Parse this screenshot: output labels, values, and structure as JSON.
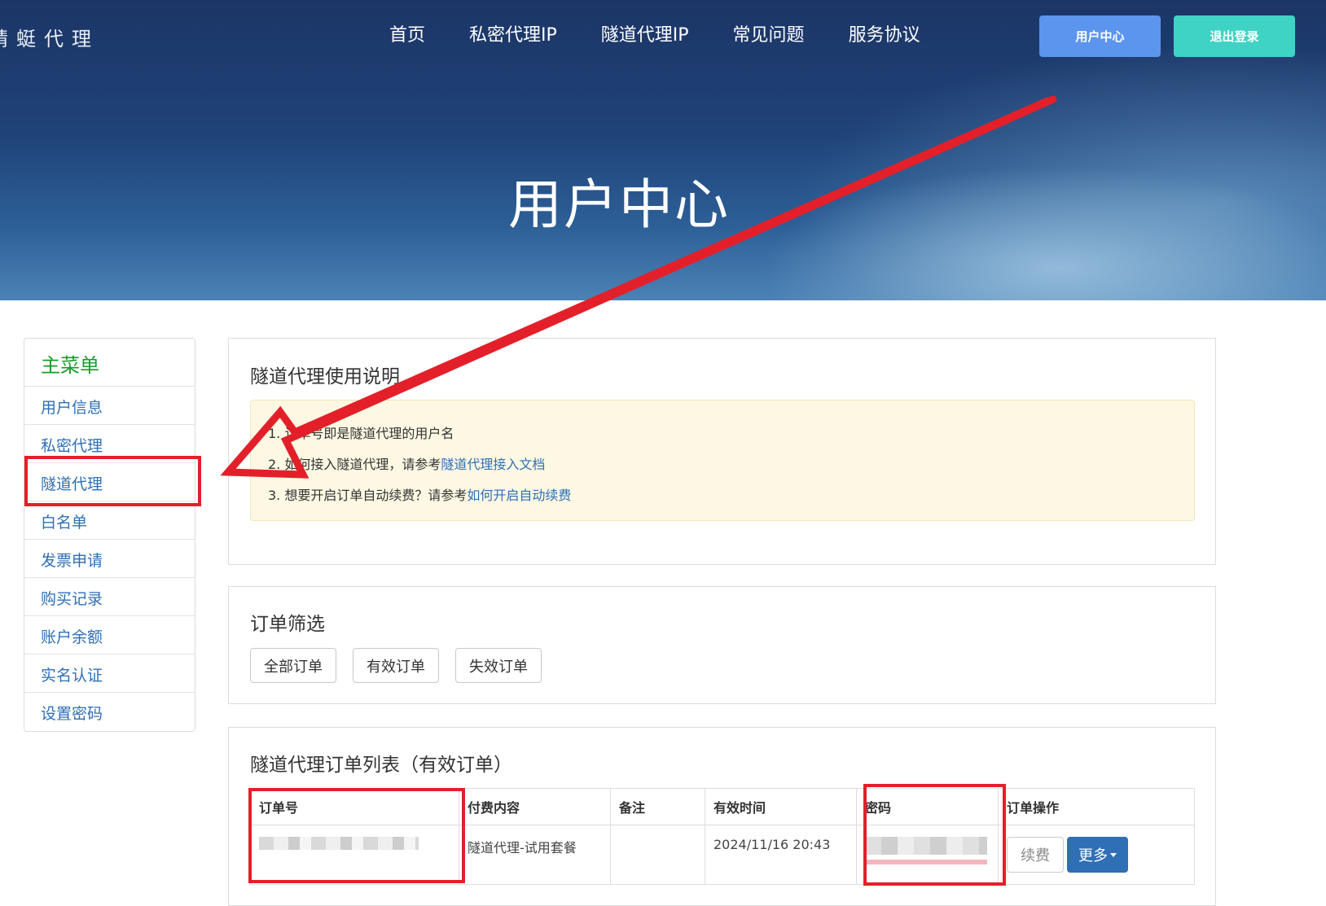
{
  "brand": {
    "logo_text": "蜻蜓代理"
  },
  "nav": {
    "items": [
      "首页",
      "私密代理IP",
      "隧道代理IP",
      "常见问题",
      "服务协议"
    ],
    "user_center_button": "用户中心",
    "logout_button": "退出登录"
  },
  "hero": {
    "title": "用户中心"
  },
  "sidebar": {
    "heading": "主菜单",
    "items": [
      "用户信息",
      "私密代理",
      "隧道代理",
      "白名单",
      "发票申请",
      "购买记录",
      "账户余额",
      "实名认证",
      "设置密码"
    ]
  },
  "usage": {
    "title": "隧道代理使用说明",
    "line1": "1. 订单号即是隧道代理的用户名",
    "line2_prefix": "2. 如何接入隧道代理，请参考",
    "line2_link": "隧道代理接入文档",
    "line3_prefix": "3. 想要开启订单自动续费？请参考",
    "line3_link": "如何开启自动续费"
  },
  "filter": {
    "title": "订单筛选",
    "buttons": [
      "全部订单",
      "有效订单",
      "失效订单"
    ]
  },
  "orders": {
    "title": "隧道代理订单列表（有效订单）",
    "columns": [
      "订单号",
      "付费内容",
      "备注",
      "有效时间",
      "密码",
      "订单操作"
    ],
    "rows": [
      {
        "content": "隧道代理-试用套餐",
        "note": "",
        "valid_time": "2024/11/16 20:43"
      }
    ],
    "renew_button": "续费",
    "more_button": "更多"
  },
  "annotation": {
    "highlight_color": "#e3202a",
    "arrow": "red-arrow-from-user-center-to-sidebar"
  }
}
